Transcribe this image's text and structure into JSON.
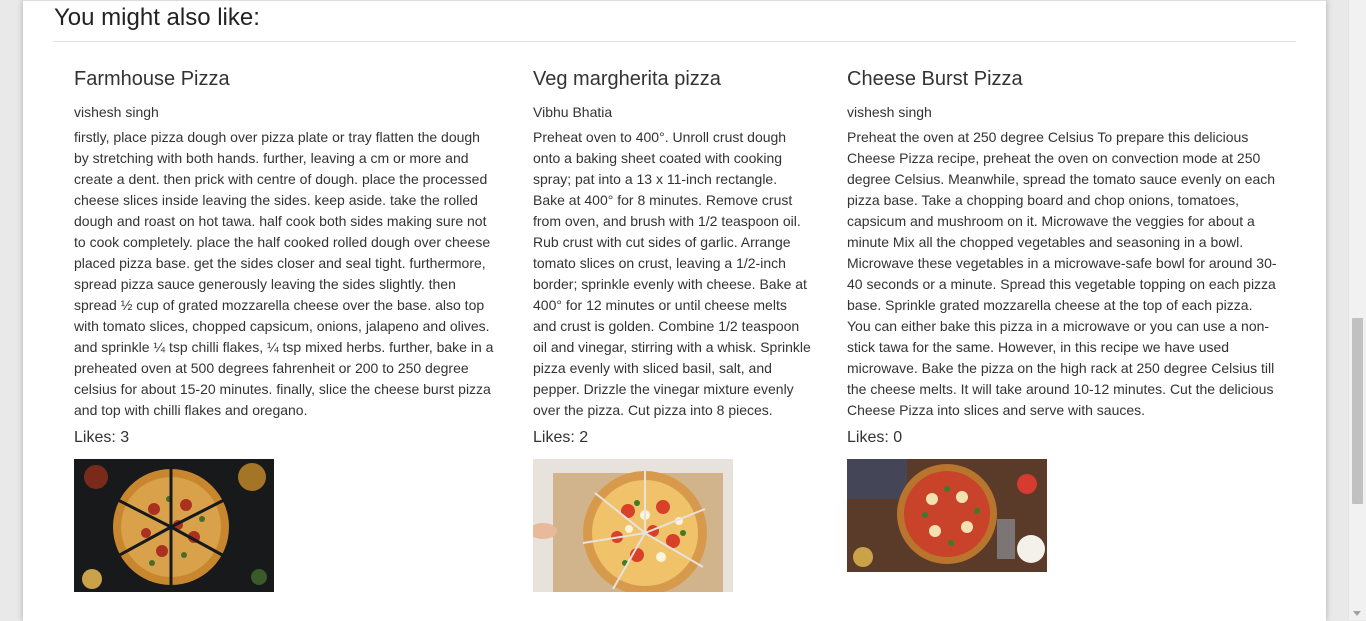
{
  "section": {
    "title": "You might also like:"
  },
  "cards": [
    {
      "title": "Farmhouse Pizza",
      "author": "vishesh singh",
      "description": "firstly, place pizza dough over pizza plate or tray flatten the dough by stretching with both hands. further, leaving a cm or more and create a dent. then prick with centre of dough. place the processed cheese slices inside leaving the sides. keep aside. take the rolled dough and roast on hot tawa. half cook both sides making sure not to cook completely. place the half cooked rolled dough over cheese placed pizza base. get the sides closer and seal tight. furthermore, spread pizza sauce generously leaving the sides slightly. then spread ½ cup of grated mozzarella cheese over the base. also top with tomato slices, chopped capsicum, onions, jalapeno and olives. and sprinkle ¼ tsp chilli flakes, ¼ tsp mixed herbs. further, bake in a preheated oven at 500 degrees fahrenheit or 200 to 250 degree celsius for about 15-20 minutes. finally, slice the cheese burst pizza and top with chilli flakes and oregano.",
      "likes_label": "Likes:",
      "likes": "3"
    },
    {
      "title": "Veg margherita pizza",
      "author": "Vibhu Bhatia",
      "description": "Preheat oven to 400°. Unroll crust dough onto a baking sheet coated with cooking spray; pat into a 13 x 11-inch rectangle. Bake at 400° for 8 minutes. Remove crust from oven, and brush with 1/2 teaspoon oil. Rub crust with cut sides of garlic. Arrange tomato slices on crust, leaving a 1/2-inch border; sprinkle evenly with cheese. Bake at 400° for 12 minutes or until cheese melts and crust is golden. Combine 1/2 teaspoon oil and vinegar, stirring with a whisk. Sprinkle pizza evenly with sliced basil, salt, and pepper. Drizzle the vinegar mixture evenly over the pizza. Cut pizza into 8 pieces.",
      "likes_label": "Likes:",
      "likes": "2"
    },
    {
      "title": "Cheese Burst Pizza",
      "author": "vishesh singh",
      "description": "Preheat the oven at 250 degree Celsius To prepare this delicious Cheese Pizza recipe, preheat the oven on convection mode at 250 degree Celsius. Meanwhile, spread the tomato sauce evenly on each pizza base. Take a chopping board and chop onions, tomatoes, capsicum and mushroom on it. Microwave the veggies for about a minute Mix all the chopped vegetables and seasoning in a bowl. Microwave these vegetables in a microwave-safe bowl for around 30-40 seconds or a minute. Spread this vegetable topping on each pizza base. Sprinkle grated mozzarella cheese at the top of each pizza. You can either bake this pizza in a microwave or you can use a non-stick tawa for the same. However, in this recipe we have used microwave. Bake the pizza on the high rack at 250 degree Celsius till the cheese melts. It will take around 10-12 minutes. Cut the delicious Cheese Pizza into slices and serve with sauces.",
      "likes_label": "Likes:",
      "likes": "0"
    }
  ]
}
